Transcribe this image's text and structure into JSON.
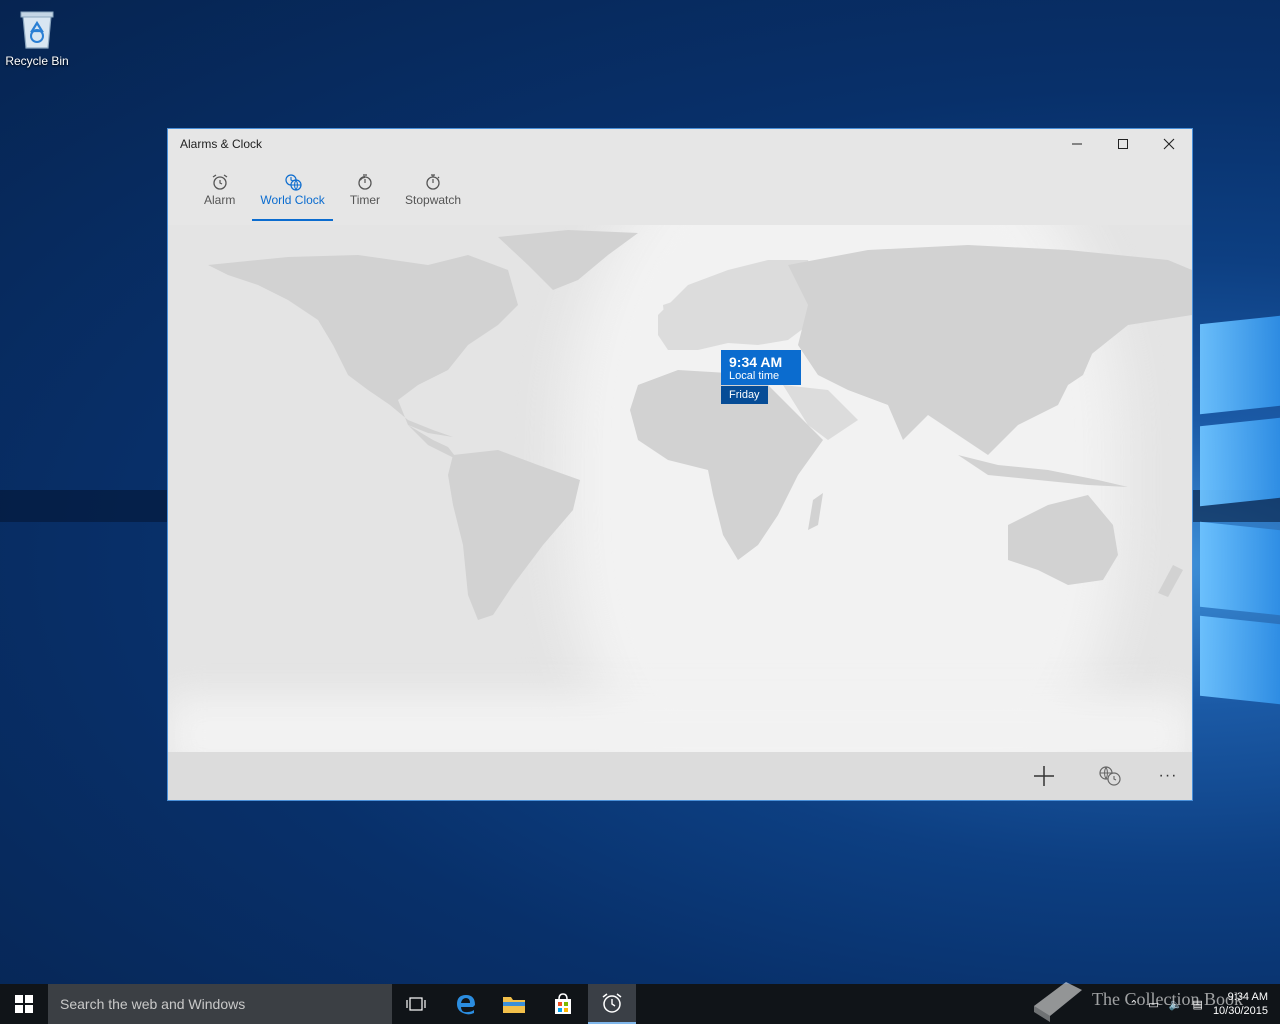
{
  "desktop": {
    "recycle_bin_label": "Recycle Bin"
  },
  "window": {
    "title": "Alarms & Clock",
    "controls": {
      "minimize": "—",
      "maximize": "☐",
      "close": "✕"
    },
    "tabs": [
      {
        "label": "Alarm",
        "icon": "alarm-icon",
        "active": false
      },
      {
        "label": "World Clock",
        "icon": "world-clock-icon",
        "active": true
      },
      {
        "label": "Timer",
        "icon": "timer-icon",
        "active": false
      },
      {
        "label": "Stopwatch",
        "icon": "stopwatch-icon",
        "active": false
      }
    ],
    "local_time": {
      "time": "9:34 AM",
      "label": "Local time",
      "day": "Friday"
    },
    "commands": [
      {
        "name": "add-button",
        "icon": "plus-icon"
      },
      {
        "name": "compare-button",
        "icon": "compare-clocks-icon"
      },
      {
        "name": "more-button",
        "icon": "more-icon",
        "label": "···"
      }
    ],
    "accent": "#0b6ccf"
  },
  "taskbar": {
    "search_placeholder": "Search the web and Windows",
    "clock_time": "9:34 AM",
    "clock_date": "10/30/2015",
    "watermark": "The Collection Book"
  }
}
